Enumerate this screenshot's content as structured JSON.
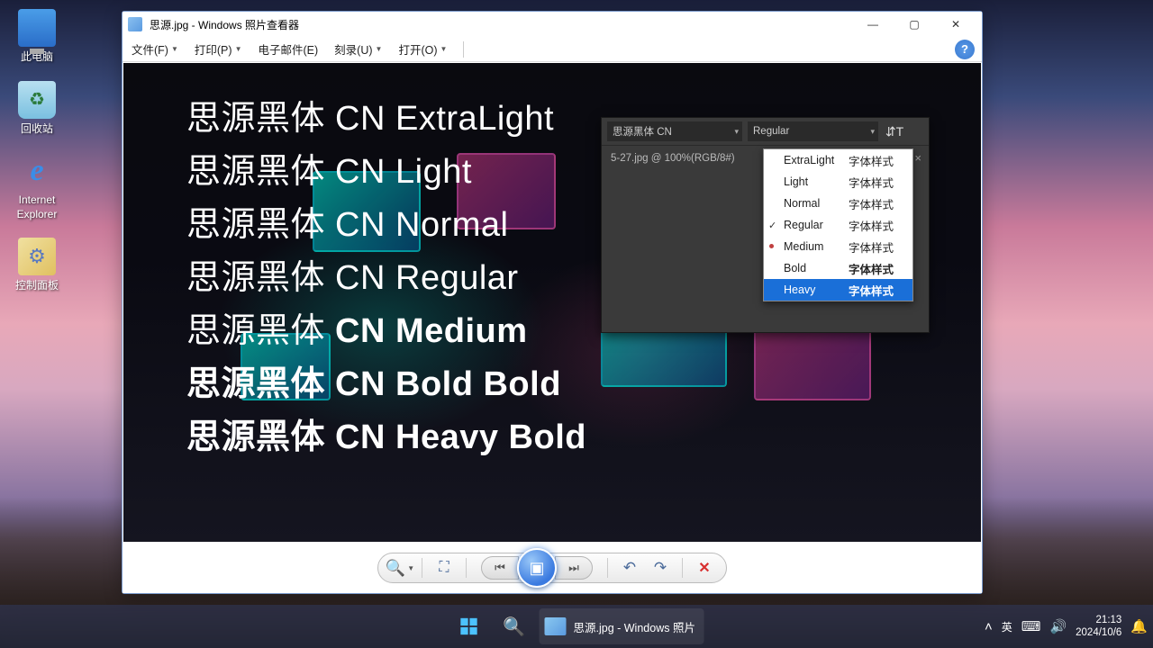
{
  "desktop": {
    "icons": [
      {
        "id": "this-pc",
        "label": "此电脑"
      },
      {
        "id": "recycle-bin",
        "label": "回收站"
      },
      {
        "id": "internet-explorer",
        "label": "Internet Explorer"
      },
      {
        "id": "control-panel",
        "label": "控制面板"
      }
    ]
  },
  "window": {
    "title": "思源.jpg - Windows 照片查看器",
    "menus": {
      "file": "文件(F)",
      "print": "打印(P)",
      "email": "电子邮件(E)",
      "burn": "刻录(U)",
      "open": "打开(O)"
    }
  },
  "image": {
    "font_lines": [
      {
        "text": "思源黑体 CN ExtraLight",
        "weight": 200,
        "size": 38
      },
      {
        "text": "思源黑体 CN Light",
        "weight": 300,
        "size": 38
      },
      {
        "text": "思源黑体 CN Normal",
        "weight": 400,
        "size": 38
      },
      {
        "text": "思源黑体 CN Regular",
        "weight": 450,
        "size": 38
      },
      {
        "text": "思源黑体 CN Medium",
        "weight": 550,
        "size": 38
      },
      {
        "text": "思源黑体 CN Bold Bold",
        "weight": 700,
        "size": 38
      },
      {
        "text": "思源黑体 CN Heavy Bold",
        "weight": 900,
        "size": 38
      }
    ]
  },
  "panel": {
    "font_family": "思源黑体 CN",
    "style_selected": "Regular",
    "tab_label": "5-27.jpg @ 100%(RGB/8#)",
    "style_suffix": "字体样式",
    "dropdown": [
      {
        "name": "ExtraLight",
        "weight": 200,
        "check": false,
        "dot": false
      },
      {
        "name": "Light",
        "weight": 300,
        "check": false,
        "dot": false
      },
      {
        "name": "Normal",
        "weight": 400,
        "check": false,
        "dot": false
      },
      {
        "name": "Regular",
        "weight": 450,
        "check": true,
        "dot": false
      },
      {
        "name": "Medium",
        "weight": 550,
        "check": false,
        "dot": true
      },
      {
        "name": "Bold",
        "weight": 700,
        "check": false,
        "dot": false
      },
      {
        "name": "Heavy",
        "weight": 900,
        "check": false,
        "dot": false,
        "selected": true
      }
    ]
  },
  "taskbar": {
    "task_title": "思源.jpg - Windows 照片查看器",
    "ime": "英",
    "time": "21:13",
    "date": "2024/10/6"
  }
}
